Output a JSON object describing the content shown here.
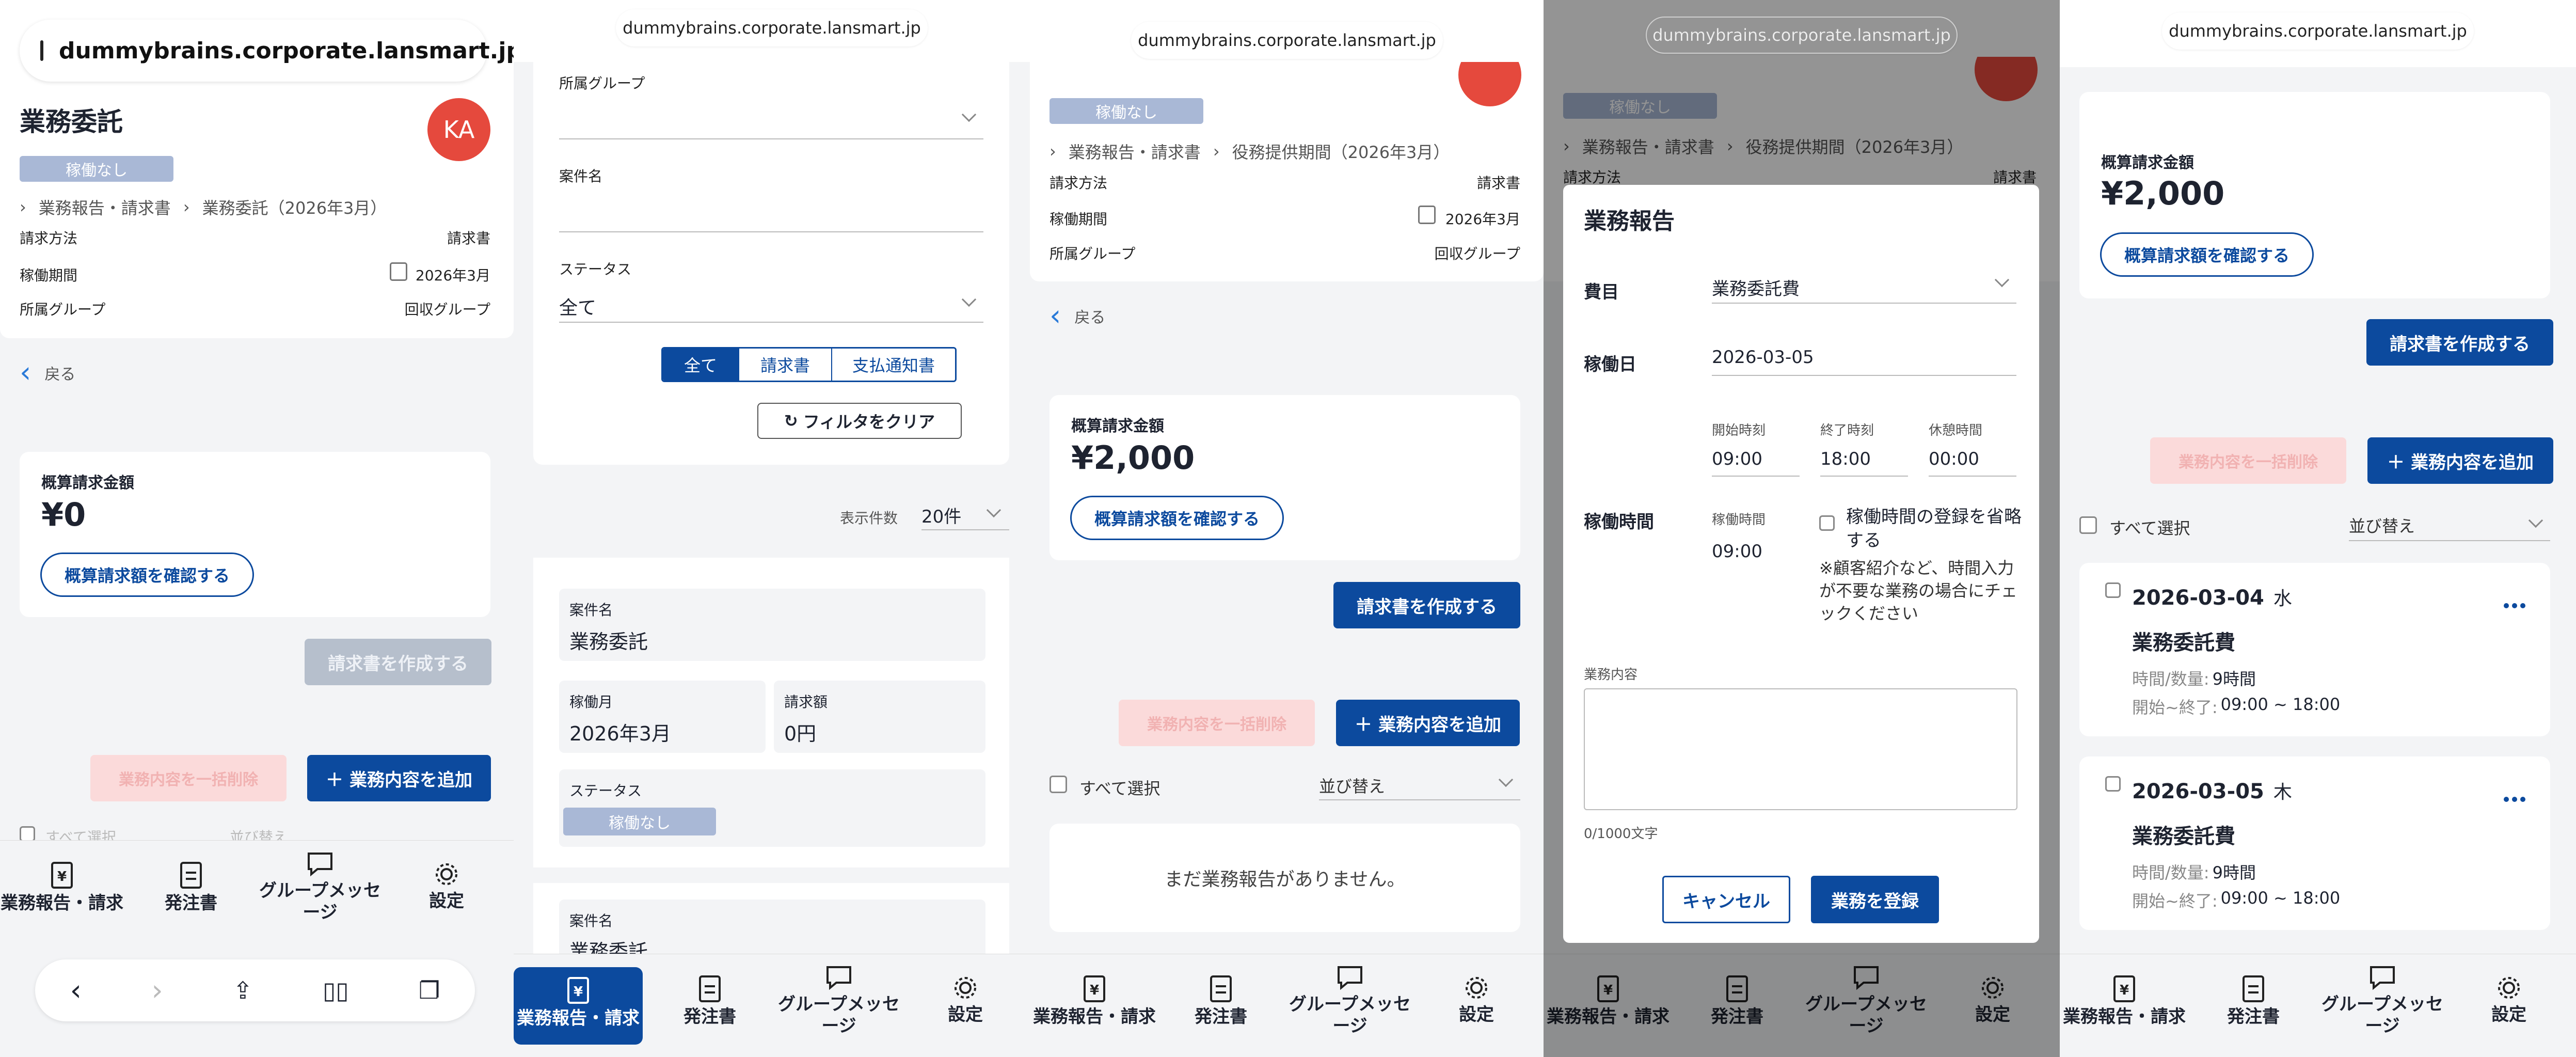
{
  "url": "dummybrains.corporate.lansmart.jp",
  "nav": {
    "reports": "業務報告・請求",
    "orders": "発注書",
    "messages": "グループメッセージ",
    "settings": "設定"
  },
  "s1": {
    "title": "業務委託",
    "avatar": "KA",
    "status": "稼働なし",
    "breadcrumb": [
      "業務報告・請求書",
      "業務委託（2026年3月）"
    ],
    "info": [
      {
        "label": "請求方法",
        "value": "請求書"
      },
      {
        "label": "稼働期間",
        "value": "2026年3月"
      },
      {
        "label": "所属グループ",
        "value": "回収グループ"
      }
    ],
    "back": "戻る",
    "estimate_label": "概算請求金額",
    "estimate_value": "¥0",
    "confirm_btn": "概算請求額を確認する",
    "create_invoice": "請求書を作成する",
    "bulk_delete": "業務内容を一括削除",
    "add_work": "業務内容を追加",
    "select_all_partial": "すべて選択",
    "sort_partial": "並び替え"
  },
  "s2": {
    "group_label": "所属グループ",
    "case_label": "案件名",
    "status_label": "ステータス",
    "status_value": "全て",
    "segments": [
      "全て",
      "請求書",
      "支払通知書"
    ],
    "clear_filter": "フィルタをクリア",
    "per_page_label": "表示件数",
    "per_page_value": "20件",
    "item": {
      "case_label": "案件名",
      "case_value": "業務委託",
      "month_label": "稼働月",
      "month_value": "2026年3月",
      "amount_label": "請求額",
      "amount_value": "0円",
      "status_label": "ステータス",
      "status_value": "稼働なし"
    },
    "item2_label": "案件名",
    "item2_value": "業務委託"
  },
  "s3": {
    "status": "稼働なし",
    "breadcrumb": [
      "業務報告・請求書",
      "役務提供期間（2026年3月）"
    ],
    "info": [
      {
        "label": "請求方法",
        "value": "請求書"
      },
      {
        "label": "稼働期間",
        "value": "2026年3月"
      },
      {
        "label": "所属グループ",
        "value": "回収グループ"
      }
    ],
    "back": "戻る",
    "estimate_label": "概算請求金額",
    "estimate_value": "¥2,000",
    "confirm_btn": "概算請求額を確認する",
    "create_invoice": "請求書を作成する",
    "bulk_delete": "業務内容を一括削除",
    "add_work": "業務内容を追加",
    "select_all": "すべて選択",
    "sort": "並び替え",
    "empty": "まだ業務報告がありません。"
  },
  "s4": {
    "modal_title": "業務報告",
    "expense_label": "費目",
    "expense_value": "業務委託費",
    "workday_label": "稼働日",
    "workday_value": "2026-03-05",
    "start_label": "開始時刻",
    "start_value": "09:00",
    "end_label": "終了時刻",
    "end_value": "18:00",
    "break_label": "休憩時間",
    "break_value": "00:00",
    "worktime_label": "稼働時間",
    "worktime_sub_label": "稼働時間",
    "worktime_value": "09:00",
    "omit_label": "稼働時間の登録を省略する",
    "omit_note": "※顧客紹介など、時間入力が不要な業務の場合にチェックください",
    "content_label": "業務内容",
    "counter": "0/1000文字",
    "cancel": "キャンセル",
    "register": "業務を登録",
    "bg_status": "稼働なし",
    "bg_breadcrumb": [
      "業務報告・請求書",
      "役務提供期間（2026年3月）"
    ],
    "bg_info_label": "請求方法",
    "bg_info_value": "請求書"
  },
  "s5": {
    "estimate_label": "概算請求金額",
    "estimate_value": "¥2,000",
    "confirm_btn": "概算請求額を確認する",
    "create_invoice": "請求書を作成する",
    "bulk_delete": "業務内容を一括削除",
    "add_work": "業務内容を追加",
    "select_all": "すべて選択",
    "sort": "並び替え",
    "items": [
      {
        "date": "2026-03-04",
        "dow": "水",
        "title": "業務委託費",
        "qty_label": "時間/数量:",
        "qty": "9時間",
        "range_label": "開始~終了:",
        "range": "09:00 ~ 18:00"
      },
      {
        "date": "2026-03-05",
        "dow": "木",
        "title": "業務委託費",
        "qty_label": "時間/数量:",
        "qty": "9時間",
        "range_label": "開始~終了:",
        "range": "09:00 ~ 18:00"
      }
    ]
  },
  "safari": {
    "back": "back-icon",
    "forward": "forward-icon",
    "share": "share-icon",
    "bookmarks": "book-icon",
    "tabs": "tabs-icon"
  },
  "colors": {
    "primary": "#0c4a9e",
    "avatar": "#e5493d",
    "chip": "#a9b8d6",
    "danger_disabled": "#fbdada"
  }
}
